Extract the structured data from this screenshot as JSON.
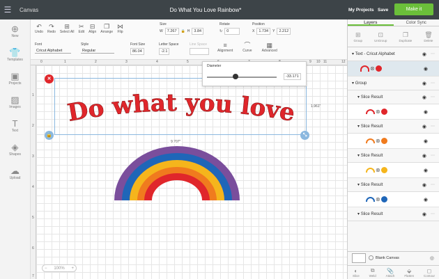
{
  "topbar": {
    "app": "Canvas",
    "project_title": "Do What You Love Rainbow*",
    "my_projects": "My Projects",
    "save": "Save",
    "make_it": "Make it"
  },
  "leftbar": [
    {
      "label": "New",
      "icon": "plus-icon"
    },
    {
      "label": "Templates",
      "icon": "shirt-icon"
    },
    {
      "label": "Projects",
      "icon": "projects-icon"
    },
    {
      "label": "Images",
      "icon": "image-icon"
    },
    {
      "label": "Text",
      "icon": "text-icon"
    },
    {
      "label": "Shapes",
      "icon": "shapes-icon"
    },
    {
      "label": "Upload",
      "icon": "upload-icon"
    }
  ],
  "toolbar": {
    "undo": "Undo",
    "redo": "Redo",
    "select_all": "Select All",
    "edit": "Edit",
    "align": "Align",
    "arrange": "Arrange",
    "flip": "Flip",
    "size_label": "Size",
    "w_label": "W",
    "w_value": "7.267",
    "h_label": "H",
    "h_value": "3.84",
    "rotate_label": "Rotate",
    "rotate_value": "0",
    "position_label": "Position",
    "x_label": "X",
    "x_value": "1.734",
    "y_label": "Y",
    "y_value": "2.212",
    "font_label": "Font",
    "font_value": "Cricut Alphabet",
    "style_label": "Style",
    "style_value": "Regular",
    "font_size_label": "Font Size",
    "font_size_value": "86.04",
    "letter_space_label": "Letter Space",
    "letter_space_value": "-2.1",
    "line_space_label": "Line Space",
    "alignment": "Alignment",
    "curve": "Curve",
    "advanced": "Advanced"
  },
  "ruler_numbers": [
    "0",
    "1",
    "2",
    "3",
    "4",
    "5",
    "6",
    "7",
    "8",
    "9",
    "10",
    "11",
    "12"
  ],
  "ruler_v_numbers": [
    "1",
    "2",
    "3",
    "4",
    "5",
    "6",
    "7"
  ],
  "diameter_popup": {
    "label": "Diameter",
    "value": "-33.171"
  },
  "canvas": {
    "text": "Do what you love",
    "height_label": "1.961\"",
    "width_label": "9.707\""
  },
  "zoom": {
    "value": "100%"
  },
  "right": {
    "tab_layers": "Layers",
    "tab_color_sync": "Color Sync",
    "actions": [
      {
        "label": "Group"
      },
      {
        "label": "UnGroup"
      },
      {
        "label": "Duplicate"
      },
      {
        "label": "Delete"
      }
    ],
    "text_layer": "Text - Cricut Alphabet",
    "group_label": "Group",
    "slice_result": "Slice Result",
    "slice_colors": [
      "#e0262b",
      "#f07b1e",
      "#f5b51c",
      "#1f66b8",
      "#7a4e9c"
    ],
    "blank_canvas": "Blank Canvas",
    "bottom_actions": [
      {
        "label": "Slice"
      },
      {
        "label": "Weld"
      },
      {
        "label": "Attach"
      },
      {
        "label": "Flatten"
      },
      {
        "label": "Contour"
      }
    ]
  }
}
